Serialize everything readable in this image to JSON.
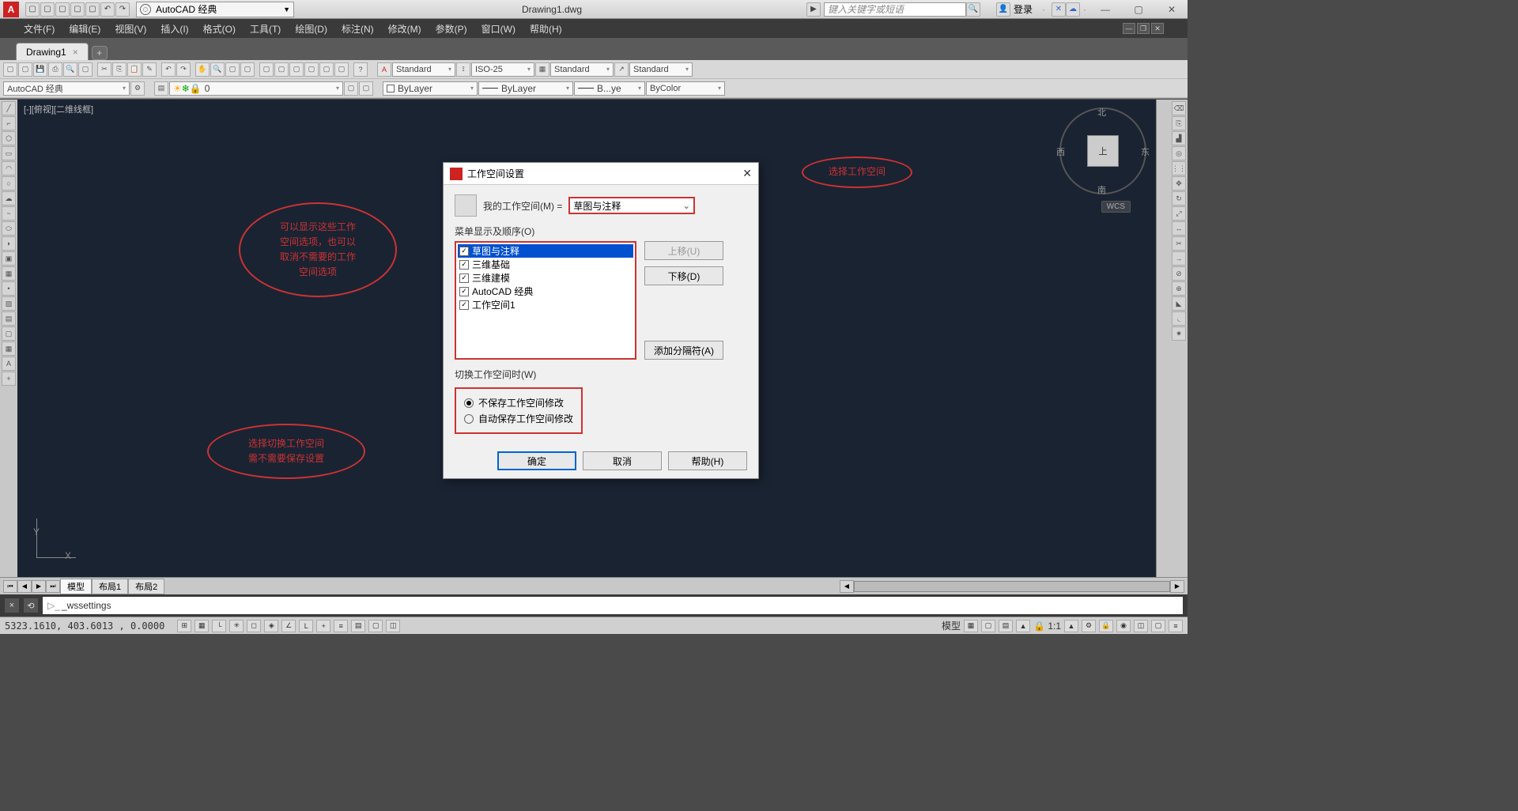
{
  "titlebar": {
    "workspace_dd": "AutoCAD 经典",
    "doc_title": "Drawing1.dwg",
    "search_ph": "键入关键字或短语",
    "login": "登录"
  },
  "menubar": {
    "items": [
      "文件(F)",
      "编辑(E)",
      "视图(V)",
      "插入(I)",
      "格式(O)",
      "工具(T)",
      "绘图(D)",
      "标注(N)",
      "修改(M)",
      "参数(P)",
      "窗口(W)",
      "帮助(H)"
    ]
  },
  "doctab": {
    "name": "Drawing1"
  },
  "toolbar2": {
    "workspace": "AutoCAD 经典",
    "layer": "0",
    "linetype1": "ByLayer",
    "linetype2": "ByLayer",
    "linetype3": "B...ye",
    "color": "ByColor",
    "style1": "Standard",
    "style2": "ISO-25",
    "style3": "Standard",
    "style4": "Standard"
  },
  "canvas": {
    "view_label": "[-][俯视][二维线框]",
    "viewcube": {
      "top": "上",
      "n": "北",
      "s": "南",
      "e": "东",
      "w": "西"
    },
    "wcs": "WCS"
  },
  "dialog": {
    "title": "工作空间设置",
    "my_ws_label": "我的工作空间(M) =",
    "my_ws_value": "草图与注释",
    "menu_order_label": "菜单显示及顺序(O)",
    "list": [
      "草图与注释",
      "三维基础",
      "三维建模",
      "AutoCAD 经典",
      "工作空间1"
    ],
    "btn_up": "上移(U)",
    "btn_down": "下移(D)",
    "btn_addsep": "添加分隔符(A)",
    "switch_label": "切换工作空间时(W)",
    "radio1": "不保存工作空间修改",
    "radio2": "自动保存工作空间修改",
    "ok": "确定",
    "cancel": "取消",
    "help": "帮助(H)"
  },
  "annotations": {
    "a1": "可以显示这些工作\n空间选项，也可以\n取消不需要的工作\n空间选项",
    "a2": "选择切换工作空间\n需不需要保存设置",
    "a3": "选择工作空间"
  },
  "modeltabs": {
    "tabs": [
      "模型",
      "布局1",
      "布局2"
    ]
  },
  "command": {
    "text": "_wssettings"
  },
  "status": {
    "coords": "5323.1610, 403.6013 , 0.0000",
    "model": "模型",
    "scale": "1:1"
  }
}
